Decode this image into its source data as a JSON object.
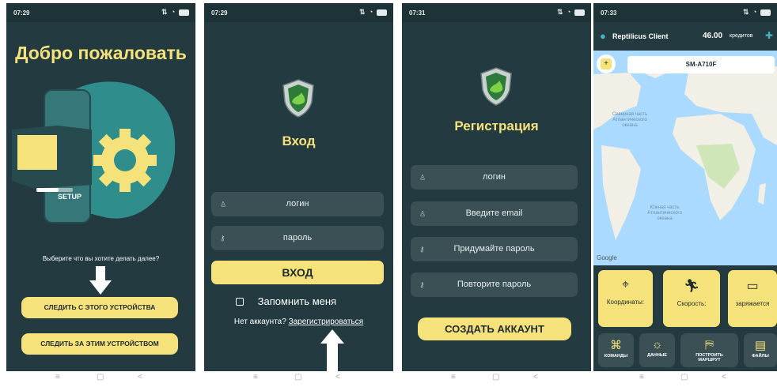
{
  "status": {
    "time1": "07:29",
    "time2": "07:29",
    "time3": "07:31",
    "time4": "07:33"
  },
  "screen1": {
    "title": "Добро пожаловать",
    "illustration_label": "SETUP",
    "prompt": "Выберите что вы хотите делать далее?",
    "btn_this_device": "СЛЕДИТЬ С ЭТОГО УСТРОЙСТВА",
    "btn_other_device": "СЛЕДИТЬ ЗА ЭТИМ УСТРОЙСТВОМ"
  },
  "screen2": {
    "title": "Вход",
    "login_placeholder": "логин",
    "password_placeholder": "пароль",
    "btn_login": "ВХОД",
    "remember": "Запомнить меня",
    "no_account": "Нет аккаунта?",
    "register_link": "Зарегистрироваться"
  },
  "screen3": {
    "title": "Регистрация",
    "login_placeholder": "логин",
    "email_placeholder": "Введите email",
    "password_placeholder": "Придумайте пароль",
    "repeat_placeholder": "Повторите пароль",
    "btn_create": "СОЗДАТЬ АККАУНТ"
  },
  "screen4": {
    "app_name": "Reptilicus Client",
    "credits": "46.00",
    "credits_unit": "кредитов",
    "device": "SM-A710F",
    "map_label_north": "Северная часть Атлантического океана",
    "map_label_south": "Южная часть Атлантического океана",
    "map_google": "Google",
    "tile_coords": "Координаты:",
    "tile_speed": "Скорость:",
    "tile_charge": "заряжается",
    "btn_commands": "КОМАНДЫ",
    "btn_data": "ДАННЫЕ",
    "btn_route": "ПОСТРОИТЬ МАРШРУТ",
    "btn_files": "ФАЙЛЫ"
  },
  "nav": {
    "home": "≡",
    "square": "▢",
    "back": "<"
  },
  "colors": {
    "bg": "#233b40",
    "accent": "#f6e27b",
    "field": "#3a5055",
    "arrow": "#ffffff",
    "map_sea": "#aadaff",
    "map_land": "#f2efe6"
  }
}
